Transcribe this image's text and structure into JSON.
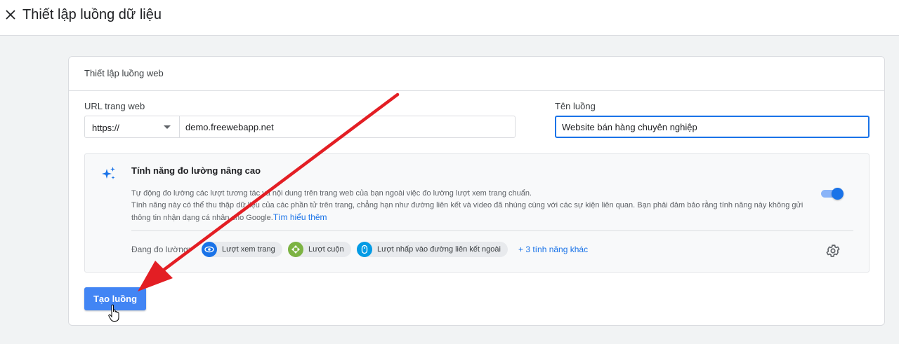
{
  "header": {
    "close_icon": "close-icon",
    "title": "Thiết lập luồng dữ liệu"
  },
  "card": {
    "title": "Thiết lập luồng web"
  },
  "url_field": {
    "label": "URL trang web",
    "protocol": "https://",
    "value": "demo.freewebapp.net"
  },
  "name_field": {
    "label": "Tên luồng",
    "value": "Website bán hàng chuyên nghiệp"
  },
  "enhanced": {
    "icon": "sparkle-icon",
    "title": "Tính năng đo lường nâng cao",
    "desc_line1": "Tự động đo lường các lượt tương tác và nội dung trên trang web của bạn ngoài việc đo lường lượt xem trang chuẩn.",
    "desc_line2": "Tính năng này có thể thu thập dữ liệu của các phần tử trên trang, chẳng hạn như đường liên kết và video đã nhúng cùng với các sự kiện liên quan. Bạn phải đảm bảo rằng tính năng này không gửi thông tin nhận dạng cá nhân cho Google.",
    "learn_more": "Tìm hiểu thêm",
    "toggle_on": true,
    "measuring_label": "Đang đo lường:",
    "chips": [
      {
        "label": "Lượt xem trang",
        "icon": "eye-icon",
        "color": "#1a73e8"
      },
      {
        "label": "Lượt cuộn",
        "icon": "scroll-icon",
        "color": "#7cb342"
      },
      {
        "label": "Lượt nhấp vào đường liên kết ngoài",
        "icon": "mouse-icon",
        "color": "#039be5"
      }
    ],
    "more_link": "+ 3 tính năng khác",
    "settings_icon": "gear-icon"
  },
  "create_button": {
    "label": "Tạo luồng"
  },
  "colors": {
    "accent": "#1a73e8",
    "button": "#4285f4",
    "annotation_arrow": "#e31e24"
  }
}
